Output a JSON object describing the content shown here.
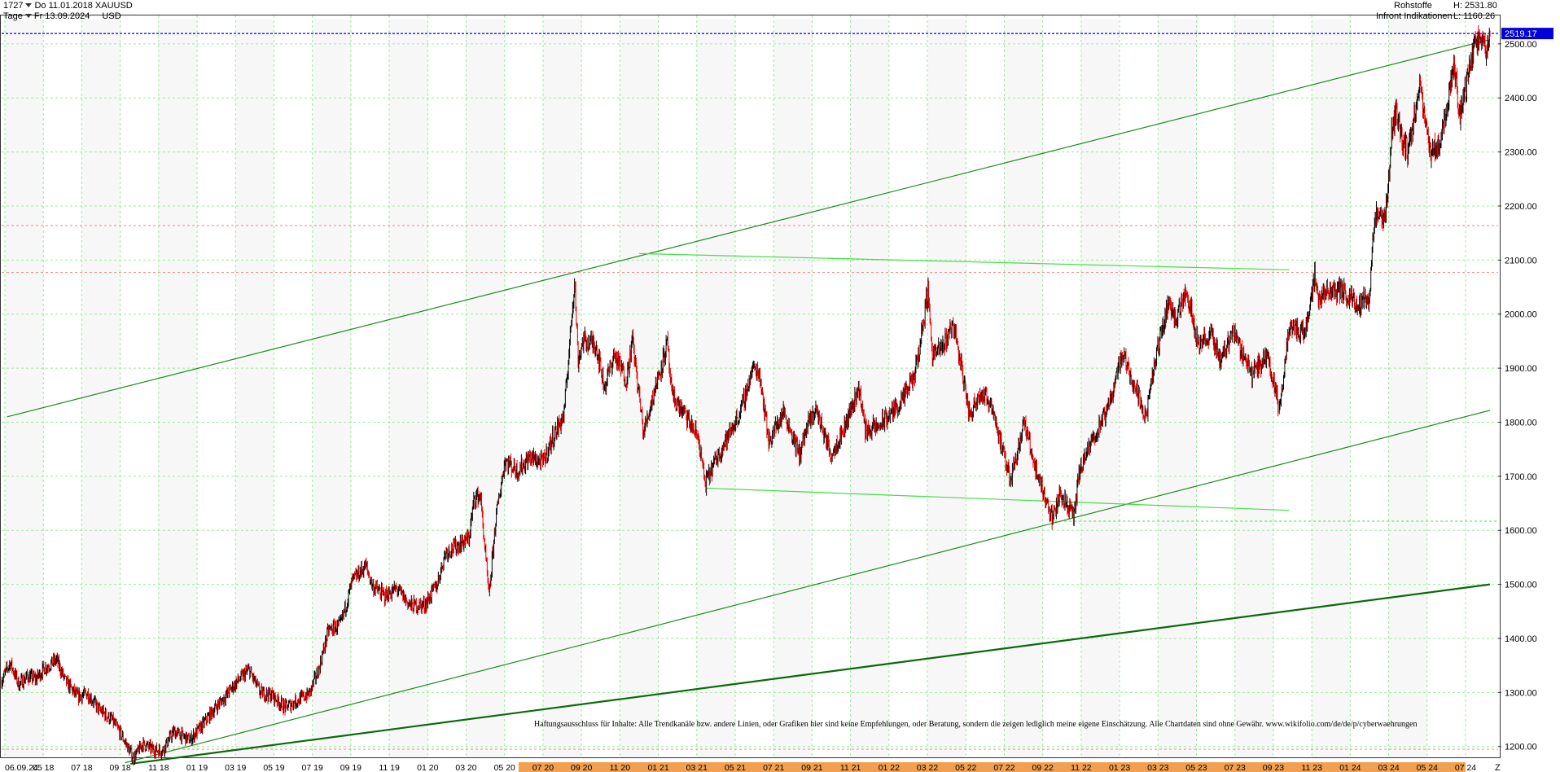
{
  "header": {
    "bars_count": "1727",
    "start_date": "Do 11.01.2018",
    "symbol": "XAUUSD",
    "period": "Tage",
    "end_date": "Fr 13.09.2024",
    "currency": "USD",
    "category": "Rohstoffe",
    "source": "Infront Indikationen",
    "high_label": "H: 2531.80",
    "low_label": "L: 1160.26"
  },
  "price_label": "2519.17",
  "corner_label": "Z",
  "disclaimer": "Haftungsausschluss für Inhalte: Alle Trendkanäle bzw. andere Linien, oder Grafiken hier sind keine Empfehlungen, oder Beratung, sondern die zeigen lediglich meine eigene Einschätzung. Alle Chartdaten sind ohne Gewähr.  www.wikifolio.com/de/de/p/cyberwaehrungen",
  "colors": {
    "up": "#000000",
    "down": "#e00000",
    "trendline": "#1e8c1e",
    "bold_trendline": "#0a6a0a",
    "range_line": "#44dd44",
    "grid": "#99ee99",
    "dotted_red": "#ee8888",
    "price_line": "#0000dd",
    "highlight_axis": "#f0a050"
  },
  "chart_data": {
    "type": "candlestick",
    "y_axis": {
      "min": 1180,
      "max": 2545,
      "ticks": [
        "1200.00",
        "1300.00",
        "1400.00",
        "1500.00",
        "1600.00",
        "1700.00",
        "1800.00",
        "1900.00",
        "2000.00",
        "2100.00",
        "2200.00",
        "2300.00",
        "2400.00",
        "2500.00"
      ]
    },
    "x_ticks": [
      "06.09.24",
      "05 18",
      "07 18",
      "09 18",
      "11 18",
      "01 19",
      "03 19",
      "05 19",
      "07 19",
      "09 19",
      "11 19",
      "01 20",
      "03 20",
      "05 20",
      "07 20",
      "09 20",
      "11 20",
      "01 21",
      "03 21",
      "05 21",
      "07 21",
      "09 21",
      "11 21",
      "01 22",
      "03 22",
      "05 22",
      "07 22",
      "09 22",
      "11 22",
      "01 23",
      "03 23",
      "05 23",
      "07 23",
      "09 23",
      "11 23",
      "01 24",
      "03 24",
      "05 24",
      "07 24"
    ],
    "highlighted_ticks_from": "07 20",
    "x_range": [
      "2018-01-11",
      "2024-09-13"
    ],
    "close_path": [
      [
        "2018-01-11",
        1322
      ],
      [
        "2018-01-25",
        1355
      ],
      [
        "2018-02-08",
        1315
      ],
      [
        "2018-02-22",
        1330
      ],
      [
        "2018-03-08",
        1325
      ],
      [
        "2018-03-22",
        1345
      ],
      [
        "2018-04-11",
        1360
      ],
      [
        "2018-04-25",
        1322
      ],
      [
        "2018-05-15",
        1292
      ],
      [
        "2018-06-01",
        1298
      ],
      [
        "2018-06-20",
        1268
      ],
      [
        "2018-07-10",
        1250
      ],
      [
        "2018-07-25",
        1224
      ],
      [
        "2018-08-15",
        1178
      ],
      [
        "2018-08-30",
        1205
      ],
      [
        "2018-09-15",
        1195
      ],
      [
        "2018-10-01",
        1192
      ],
      [
        "2018-10-20",
        1228
      ],
      [
        "2018-11-15",
        1212
      ],
      [
        "2018-12-05",
        1238
      ],
      [
        "2018-12-20",
        1262
      ],
      [
        "2019-01-10",
        1290
      ],
      [
        "2019-01-30",
        1318
      ],
      [
        "2019-02-20",
        1342
      ],
      [
        "2019-03-10",
        1300
      ],
      [
        "2019-03-30",
        1295
      ],
      [
        "2019-04-20",
        1272
      ],
      [
        "2019-05-10",
        1285
      ],
      [
        "2019-05-30",
        1298
      ],
      [
        "2019-06-15",
        1345
      ],
      [
        "2019-06-30",
        1415
      ],
      [
        "2019-07-20",
        1425
      ],
      [
        "2019-08-08",
        1505
      ],
      [
        "2019-08-30",
        1535
      ],
      [
        "2019-09-10",
        1498
      ],
      [
        "2019-09-30",
        1478
      ],
      [
        "2019-10-20",
        1492
      ],
      [
        "2019-11-12",
        1460
      ],
      [
        "2019-12-05",
        1462
      ],
      [
        "2019-12-25",
        1500
      ],
      [
        "2020-01-08",
        1560
      ],
      [
        "2020-01-25",
        1570
      ],
      [
        "2020-02-15",
        1585
      ],
      [
        "2020-02-24",
        1660
      ],
      [
        "2020-03-05",
        1665
      ],
      [
        "2020-03-12",
        1570
      ],
      [
        "2020-03-19",
        1475
      ],
      [
        "2020-03-30",
        1620
      ],
      [
        "2020-04-14",
        1730
      ],
      [
        "2020-05-05",
        1710
      ],
      [
        "2020-05-25",
        1735
      ],
      [
        "2020-06-15",
        1725
      ],
      [
        "2020-07-01",
        1770
      ],
      [
        "2020-07-20",
        1815
      ],
      [
        "2020-07-30",
        1960
      ],
      [
        "2020-08-06",
        2065
      ],
      [
        "2020-08-12",
        1915
      ],
      [
        "2020-08-20",
        1950
      ],
      [
        "2020-09-10",
        1945
      ],
      [
        "2020-09-24",
        1865
      ],
      [
        "2020-10-10",
        1925
      ],
      [
        "2020-10-30",
        1880
      ],
      [
        "2020-11-09",
        1952
      ],
      [
        "2020-11-27",
        1780
      ],
      [
        "2020-12-15",
        1860
      ],
      [
        "2021-01-05",
        1945
      ],
      [
        "2021-01-12",
        1850
      ],
      [
        "2021-02-05",
        1810
      ],
      [
        "2021-02-25",
        1770
      ],
      [
        "2021-03-08",
        1685
      ],
      [
        "2021-03-25",
        1730
      ],
      [
        "2021-04-15",
        1775
      ],
      [
        "2021-05-05",
        1820
      ],
      [
        "2021-05-25",
        1900
      ],
      [
        "2021-06-05",
        1893
      ],
      [
        "2021-06-20",
        1765
      ],
      [
        "2021-07-15",
        1820
      ],
      [
        "2021-08-09",
        1740
      ],
      [
        "2021-08-20",
        1785
      ],
      [
        "2021-09-05",
        1825
      ],
      [
        "2021-09-30",
        1740
      ],
      [
        "2021-10-20",
        1785
      ],
      [
        "2021-11-15",
        1865
      ],
      [
        "2021-11-25",
        1785
      ],
      [
        "2021-12-15",
        1790
      ],
      [
        "2022-01-05",
        1815
      ],
      [
        "2022-01-25",
        1840
      ],
      [
        "2022-02-15",
        1890
      ],
      [
        "2022-03-08",
        2045
      ],
      [
        "2022-03-15",
        1925
      ],
      [
        "2022-03-30",
        1935
      ],
      [
        "2022-04-18",
        1985
      ],
      [
        "2022-05-05",
        1880
      ],
      [
        "2022-05-15",
        1810
      ],
      [
        "2022-05-30",
        1855
      ],
      [
        "2022-06-20",
        1835
      ],
      [
        "2022-07-10",
        1735
      ],
      [
        "2022-07-21",
        1695
      ],
      [
        "2022-08-12",
        1800
      ],
      [
        "2022-09-01",
        1710
      ],
      [
        "2022-09-28",
        1620
      ],
      [
        "2022-10-10",
        1670
      ],
      [
        "2022-11-02",
        1625
      ],
      [
        "2022-11-10",
        1705
      ],
      [
        "2022-12-05",
        1775
      ],
      [
        "2022-12-25",
        1815
      ],
      [
        "2023-01-20",
        1930
      ],
      [
        "2023-02-10",
        1865
      ],
      [
        "2023-02-28",
        1810
      ],
      [
        "2023-03-15",
        1915
      ],
      [
        "2023-04-05",
        2020
      ],
      [
        "2023-04-20",
        1990
      ],
      [
        "2023-05-04",
        2050
      ],
      [
        "2023-05-25",
        1945
      ],
      [
        "2023-06-15",
        1960
      ],
      [
        "2023-06-30",
        1915
      ],
      [
        "2023-07-20",
        1970
      ],
      [
        "2023-08-20",
        1890
      ],
      [
        "2023-09-15",
        1925
      ],
      [
        "2023-10-05",
        1820
      ],
      [
        "2023-10-20",
        1980
      ],
      [
        "2023-11-15",
        1965
      ],
      [
        "2023-12-01",
        2075
      ],
      [
        "2023-12-04",
        2030
      ],
      [
        "2023-12-20",
        2040
      ],
      [
        "2024-01-10",
        2045
      ],
      [
        "2024-02-10",
        2020
      ],
      [
        "2024-02-28",
        2030
      ],
      [
        "2024-03-08",
        2180
      ],
      [
        "2024-03-25",
        2170
      ],
      [
        "2024-04-05",
        2330
      ],
      [
        "2024-04-12",
        2380
      ],
      [
        "2024-04-22",
        2320
      ],
      [
        "2024-05-03",
        2300
      ],
      [
        "2024-05-20",
        2425
      ],
      [
        "2024-06-07",
        2295
      ],
      [
        "2024-06-25",
        2325
      ],
      [
        "2024-07-16",
        2465
      ],
      [
        "2024-07-26",
        2370
      ],
      [
        "2024-08-05",
        2420
      ],
      [
        "2024-08-20",
        2510
      ],
      [
        "2024-09-06",
        2495
      ],
      [
        "2024-09-13",
        2519
      ]
    ],
    "trend_lines": [
      {
        "from": [
          "2018-01-20",
          1810
        ],
        "to": [
          "2024-09-13",
          2508
        ]
      },
      {
        "from": [
          "2018-08-01",
          1170
        ],
        "to": [
          "2024-09-13",
          1822
        ]
      },
      {
        "from": [
          "2018-08-10",
          1168
        ],
        "to": [
          "2024-09-13",
          1500
        ],
        "bold": true
      },
      {
        "from": [
          "2020-11-20",
          2112
        ],
        "to": [
          "2023-10-20",
          2082
        ],
        "color": "range"
      },
      {
        "from": [
          "2021-03-10",
          1678
        ],
        "to": [
          "2023-10-20",
          1637
        ],
        "color": "range"
      }
    ],
    "horizontal_levels": [
      {
        "value": 2519.17,
        "style": "price"
      },
      {
        "value": 2164,
        "style": "red-dotted"
      },
      {
        "value": 2077,
        "style": "red-dotted"
      },
      {
        "value": 1195,
        "style": "red-dotted"
      },
      {
        "value": 1617,
        "style": "green-dotted",
        "from": "2022-10-01"
      }
    ]
  }
}
